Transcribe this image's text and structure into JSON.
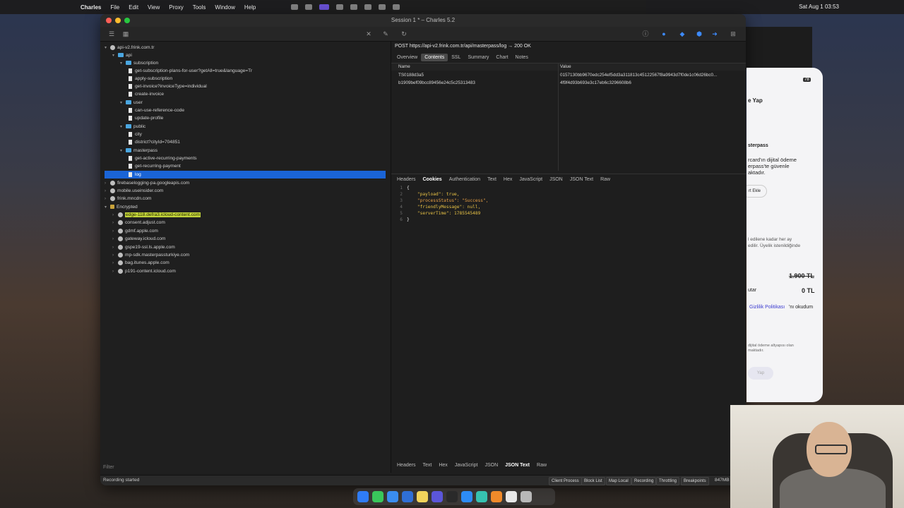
{
  "menubar": {
    "app": "Charles",
    "items": [
      "File",
      "Edit",
      "View",
      "Proxy",
      "Tools",
      "Window",
      "Help"
    ],
    "clock": "Sat Aug 1  03:53"
  },
  "window": {
    "title": "Session 1 * – Charles 5.2"
  },
  "tree": {
    "host": "api-v2.frink.com.tr",
    "api": "api",
    "subscription": "subscription",
    "sub_items": [
      "get-subscription-plans-for-user?getAll=true&language=Tr",
      "apply-subscription",
      "get-invoice?invoiceType=individual",
      "create-invoice"
    ],
    "user": "user",
    "user_items": [
      "can-use-reference-code",
      "update-profile"
    ],
    "public": "public",
    "public_items": [
      "city",
      "district?cityId=704851"
    ],
    "masterpass": "masterpass",
    "masterpass_items": [
      "get-active-recurring-payments",
      "get-recurring-payment",
      "log"
    ],
    "other_hosts": [
      "firebaselogging-pa.googleapis.com",
      "mobile.useinsider.com",
      "frink.mncdn.com"
    ],
    "encrypted": "Encrypted",
    "encrypted_hosts": [
      "edge-118.defra3.icloud-content.com",
      "consent.adjust.com",
      "gdmf.apple.com",
      "gateway.icloud.com",
      "gspe19-ssl.ls.apple.com",
      "mp-sdk.masterpassturkiye.com",
      "bag.itunes.apple.com",
      "p191-content.icloud.com"
    ],
    "filter_label": "Filter"
  },
  "detail": {
    "request_line": "POST https://api-v2.frink.com.tr/api/masterpass/log → 200 OK",
    "top_tabs": [
      "Overview",
      "Contents",
      "SSL",
      "Summary",
      "Chart",
      "Notes"
    ],
    "table_headers": {
      "name": "Name",
      "value": "Value"
    },
    "rows": [
      {
        "name": "TS0188d3a5",
        "value": "0157130bb9670edc254ef5dd3a311813c45122567f8a9943d7f0de1c06d26bc0..."
      },
      {
        "name": "b1909bef09bcc89456e24c5c25313483",
        "value": "4f9f4d93b693e3c17eb6c3296608b6"
      }
    ],
    "mid_tabs": [
      "Headers",
      "Cookies",
      "Authentication",
      "Text",
      "Hex",
      "JavaScript",
      "JSON",
      "JSON Text",
      "Raw"
    ],
    "code_lines": [
      {
        "n": "1",
        "t": "{"
      },
      {
        "n": "2",
        "t": "    \"payload\": true,"
      },
      {
        "n": "3",
        "t": "    \"processStatus\": \"Success\","
      },
      {
        "n": "4",
        "t": "    \"friendlyMessage\": null,"
      },
      {
        "n": "5",
        "t": "    \"serverTime\": 1785545489"
      },
      {
        "n": "6",
        "t": "}"
      }
    ],
    "bottom_tabs": [
      "Headers",
      "Text",
      "Hex",
      "JavaScript",
      "JSON",
      "JSON Text",
      "Raw"
    ]
  },
  "status": {
    "text": "Recording started",
    "buttons": [
      "Client Process",
      "Block List",
      "Map Local",
      "Recording",
      "Throttling",
      "Breakpoints"
    ],
    "memory": "847MB"
  },
  "phone": {
    "time_icons": "78",
    "title": "e Yap",
    "masterpass": "sterpass",
    "desc1": "rcard'ın dijital ödeme",
    "desc2": "erpass'te güvenle",
    "desc3": "aktadır.",
    "add_card": "rt Ekle",
    "note1": "l edilene kadar her ay",
    "note2": "edilir. Üyelik istenildiğinde",
    "price_old": "1.900 TL",
    "amount_label": "utar",
    "amount": "0 TL",
    "privacy_link": "Gizlilik Politikası",
    "privacy_rest": "'nı okudum",
    "footer1": "dijital ödeme altyapısı olan",
    "footer2": "maktadır.",
    "pay_btn": "Yap"
  }
}
